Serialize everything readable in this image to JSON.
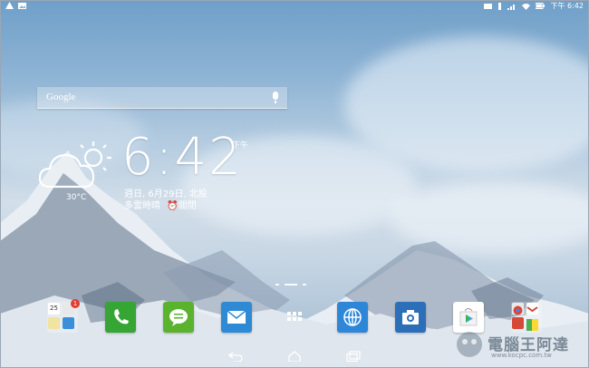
{
  "status_bar": {
    "time": "下午 6:42",
    "left_icons": [
      "notification-a-icon",
      "image-notification-icon"
    ],
    "right_icons": [
      "sync-icon",
      "vibrate-icon",
      "signal-icon",
      "wifi-icon",
      "battery-icon"
    ]
  },
  "search": {
    "logo": "Google",
    "mic_icon": "microphone-icon"
  },
  "weather": {
    "icon": "partly-cloudy-icon",
    "temperature": "30°C",
    "condition": "多雲時晴",
    "alarm": "⏰關閉"
  },
  "clock": {
    "time": "6:42",
    "ampm": "下午",
    "date": "週日, 6月29日, 北投"
  },
  "pager": {
    "pages": 3,
    "active": 1
  },
  "dock": {
    "apps": [
      {
        "name": "folder-calendar-tasks",
        "icon": "folder-icon",
        "badge": "1"
      },
      {
        "name": "phone-app",
        "icon": "phone-icon",
        "color": "#35a534"
      },
      {
        "name": "messaging-app",
        "icon": "chat-icon",
        "color": "#5ab32c"
      },
      {
        "name": "email-app",
        "icon": "envelope-icon",
        "color": "#2f8ad6"
      },
      {
        "name": "all-apps",
        "icon": "grid-icon"
      },
      {
        "name": "browser-app",
        "icon": "globe-icon",
        "color": "#2e86d8"
      },
      {
        "name": "camera-app",
        "icon": "camera-icon",
        "color": "#2a6fb8"
      },
      {
        "name": "play-store-app",
        "icon": "play-store-icon",
        "color": "#ffffff"
      },
      {
        "name": "folder-google",
        "icon": "folder-icon"
      }
    ],
    "calendar_day": "25"
  },
  "navbar": {
    "icons": [
      "back-icon",
      "home-icon",
      "recents-icon"
    ]
  },
  "watermark": {
    "text": "電腦王阿達",
    "url": "www.kocpc.com.tw"
  }
}
